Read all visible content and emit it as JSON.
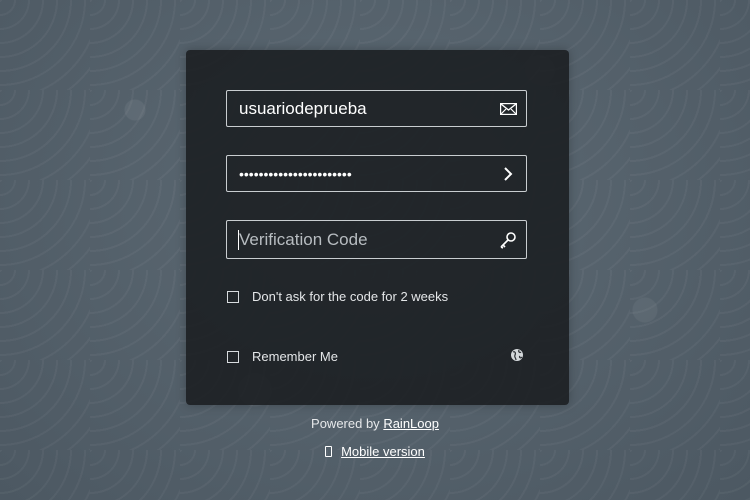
{
  "login_form": {
    "login_value": "usuariodeprueba",
    "password_value": "•••••••••••••••••••••••",
    "verification_placeholder": "Verification Code",
    "two_weeks_label": "Don't ask for the code for 2 weeks",
    "remember_label": "Remember Me"
  },
  "icons": {
    "login_field": "envelope-icon",
    "password_field": "chevron-right-icon",
    "verification_field": "key-icon",
    "language": "globe-icon",
    "mobile": "phone-icon"
  },
  "footer": {
    "powered_by_text": "Powered by",
    "rainloop_link": "RainLoop",
    "mobile_link": "Mobile version"
  },
  "colors": {
    "background": "#55606a",
    "panel": "#1c1f22",
    "border": "#c9cdd0",
    "text": "#ffffff"
  }
}
